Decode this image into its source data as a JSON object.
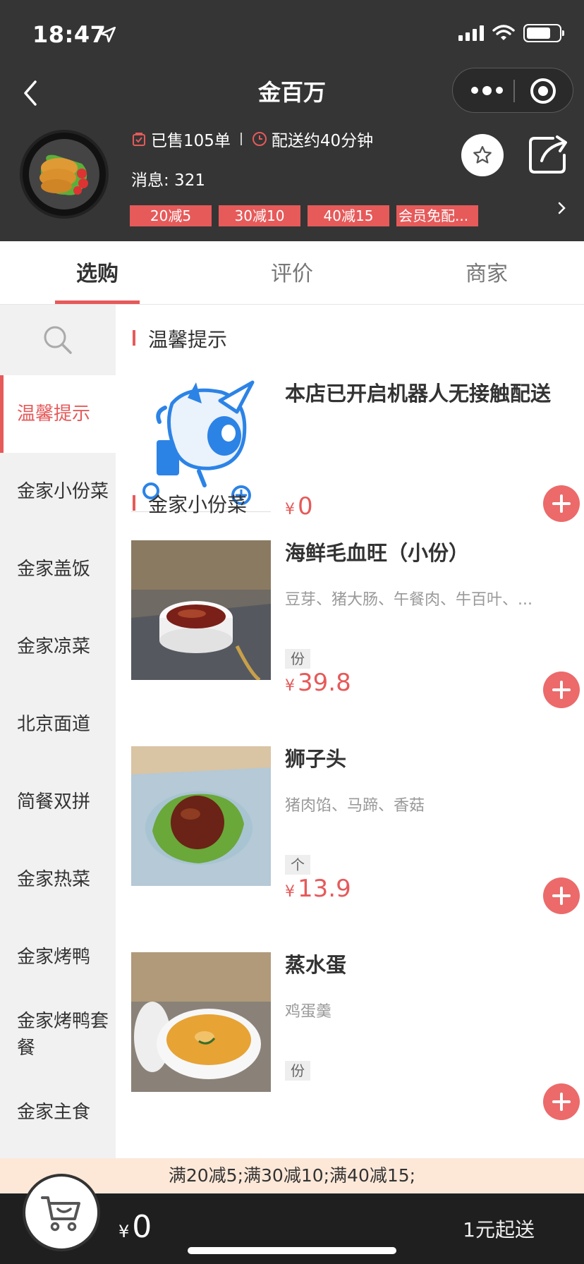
{
  "status_bar": {
    "time": "18:47"
  },
  "header": {
    "title": "金百万",
    "sold": "已售105单",
    "delivery": "配送约40分钟",
    "message": "消息: 321",
    "tags": [
      "20减5",
      "30减10",
      "40减15",
      "会员免配..."
    ]
  },
  "tabs": [
    {
      "label": "选购",
      "active": true
    },
    {
      "label": "评价",
      "active": false
    },
    {
      "label": "商家",
      "active": false
    }
  ],
  "sidebar": {
    "categories": [
      {
        "label": "温馨提示",
        "active": true
      },
      {
        "label": "金家小份菜",
        "active": false
      },
      {
        "label": "金家盖饭",
        "active": false
      },
      {
        "label": "金家凉菜",
        "active": false
      },
      {
        "label": "北京面道",
        "active": false
      },
      {
        "label": "简餐双拼",
        "active": false
      },
      {
        "label": "金家热菜",
        "active": false
      },
      {
        "label": "金家烤鸭",
        "active": false
      },
      {
        "label": "金家烤鸭套餐",
        "active": false
      },
      {
        "label": "金家主食",
        "active": false
      }
    ]
  },
  "sections": [
    {
      "title": "温馨提示",
      "items": [
        {
          "name": "本店已开启机器人无接触配送",
          "desc": "",
          "unit": "",
          "currency": "¥",
          "price": "0"
        }
      ]
    },
    {
      "title": "金家小份菜",
      "items": [
        {
          "name": "海鲜毛血旺（小份）",
          "desc": "豆芽、猪大肠、午餐肉、牛百叶、...",
          "unit": "份",
          "currency": "¥",
          "price": "39.8"
        },
        {
          "name": "狮子头",
          "desc": "猪肉馅、马蹄、香菇",
          "unit": "个",
          "currency": "¥",
          "price": "13.9"
        },
        {
          "name": "蒸水蛋",
          "desc": "鸡蛋羹",
          "unit": "份",
          "currency": "¥",
          "price": ""
        }
      ]
    }
  ],
  "promo": "满20减5;满30减10;满40减15;",
  "cart": {
    "currency": "¥",
    "total": "0",
    "min_order": "1元起送"
  },
  "colors": {
    "accent": "#e65a5a",
    "header_bg": "#353535",
    "promo_bg": "#fde8d8"
  }
}
